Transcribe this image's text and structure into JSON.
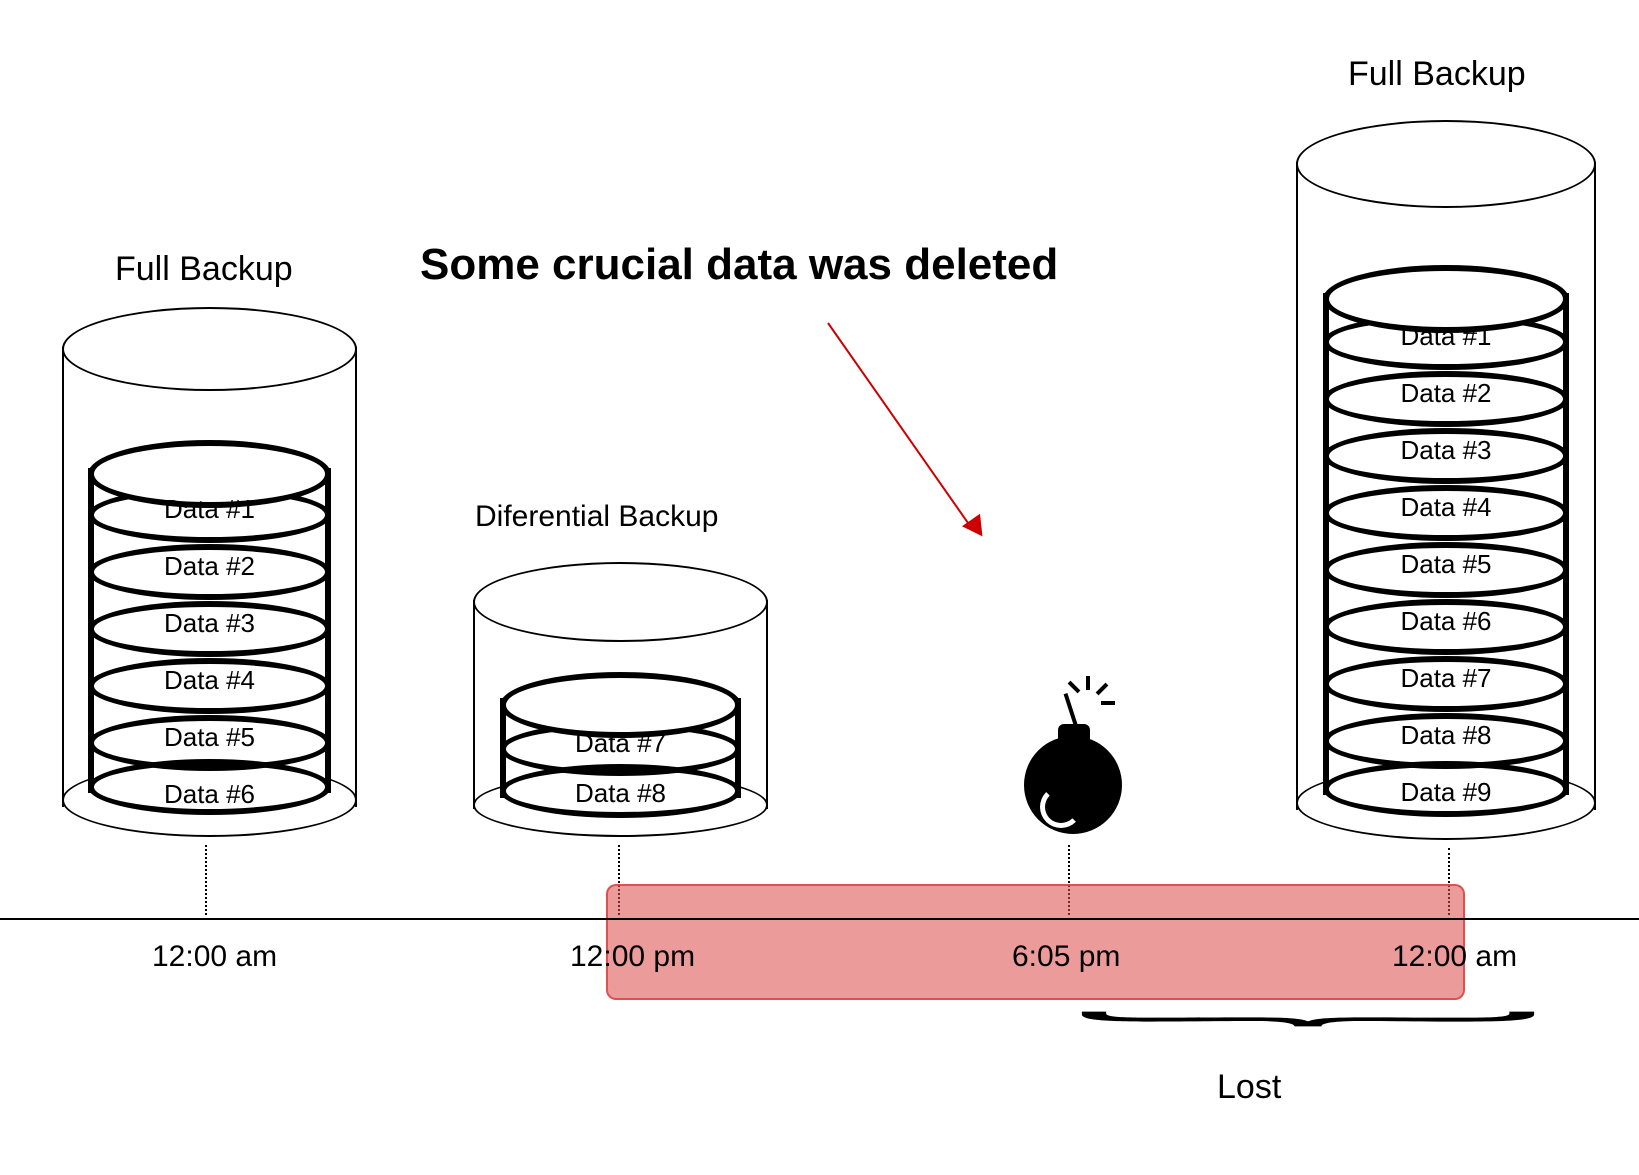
{
  "annotation": {
    "text": "Some crucial data was deleted"
  },
  "cylinders": {
    "left": {
      "title": "Full Backup",
      "disks": [
        "Data #1",
        "Data #2",
        "Data #3",
        "Data #4",
        "Data #5",
        "Data #6"
      ]
    },
    "middle": {
      "title": "Diferential Backup",
      "disks": [
        "Data #7",
        "Data #8"
      ]
    },
    "right": {
      "title": "Full Backup",
      "disks": [
        "Data #1",
        "Data #2",
        "Data #3",
        "Data #4",
        "Data #5",
        "Data #6",
        "Data #7",
        "Data #8",
        "Data #9"
      ]
    }
  },
  "timeline": {
    "t1": "12:00 am",
    "t2": "12:00 pm",
    "t3": "6:05 pm",
    "t4": "12:00 am"
  },
  "lost_label": "Lost",
  "colors": {
    "danger_fill": "#dd4848",
    "arrow": "#cc0000"
  }
}
